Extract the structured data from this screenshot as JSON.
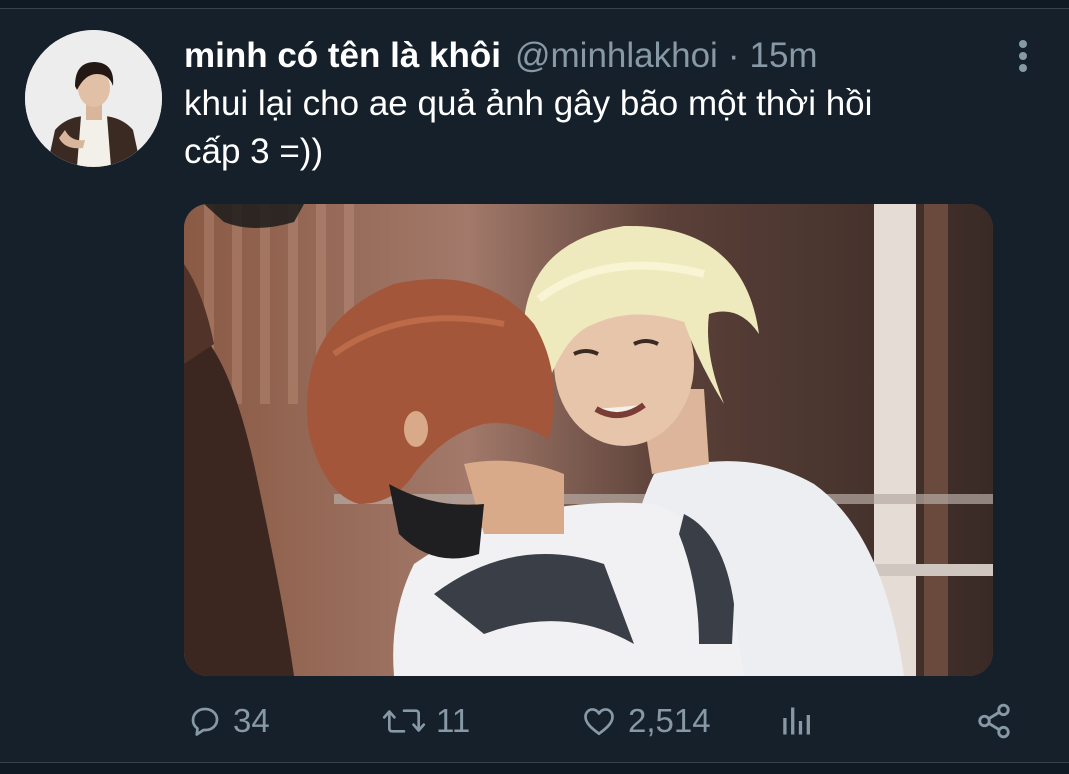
{
  "tweet": {
    "display_name": "minh có tên là khôi",
    "handle": "@minhlakhoi",
    "separator": "·",
    "time": "15m",
    "text": "khui lại cho ae quả ảnh gây bão một thời hồi\ncấp 3 =))"
  },
  "actions": {
    "reply_count": "34",
    "retweet_count": "11",
    "like_count": "2,514"
  },
  "icons": {
    "reply": "reply-icon",
    "retweet": "retweet-icon",
    "like": "heart-icon",
    "analytics": "analytics-icon",
    "share": "share-icon",
    "more": "more-vertical-icon"
  },
  "colors": {
    "background": "#15202b",
    "secondary_text": "#8899a6",
    "primary_text": "#ffffff"
  }
}
